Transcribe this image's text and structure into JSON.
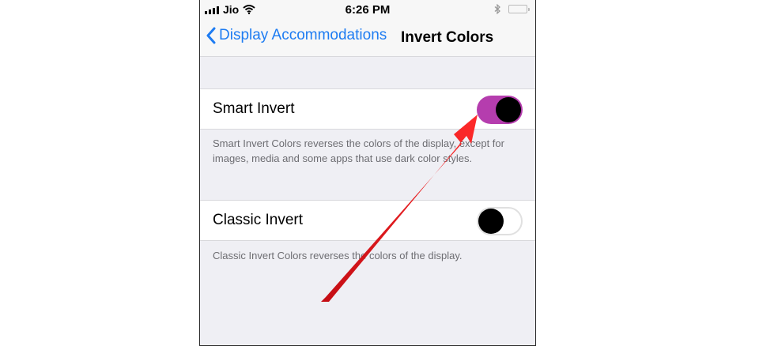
{
  "status_bar": {
    "carrier": "Jio",
    "time": "6:26 PM"
  },
  "nav": {
    "back_label": "Display Accommodations",
    "title": "Invert Colors"
  },
  "settings": [
    {
      "label": "Smart Invert",
      "enabled": true,
      "footer": "Smart Invert Colors reverses the colors of the display, except for images, media and some apps that use dark color styles."
    },
    {
      "label": "Classic Invert",
      "enabled": false,
      "footer": "Classic Invert Colors reverses the colors of the display."
    }
  ],
  "colors": {
    "accent": "#1e7cf2",
    "toggle_on": "#b53dae",
    "annotation_arrow": "#e3121a"
  }
}
